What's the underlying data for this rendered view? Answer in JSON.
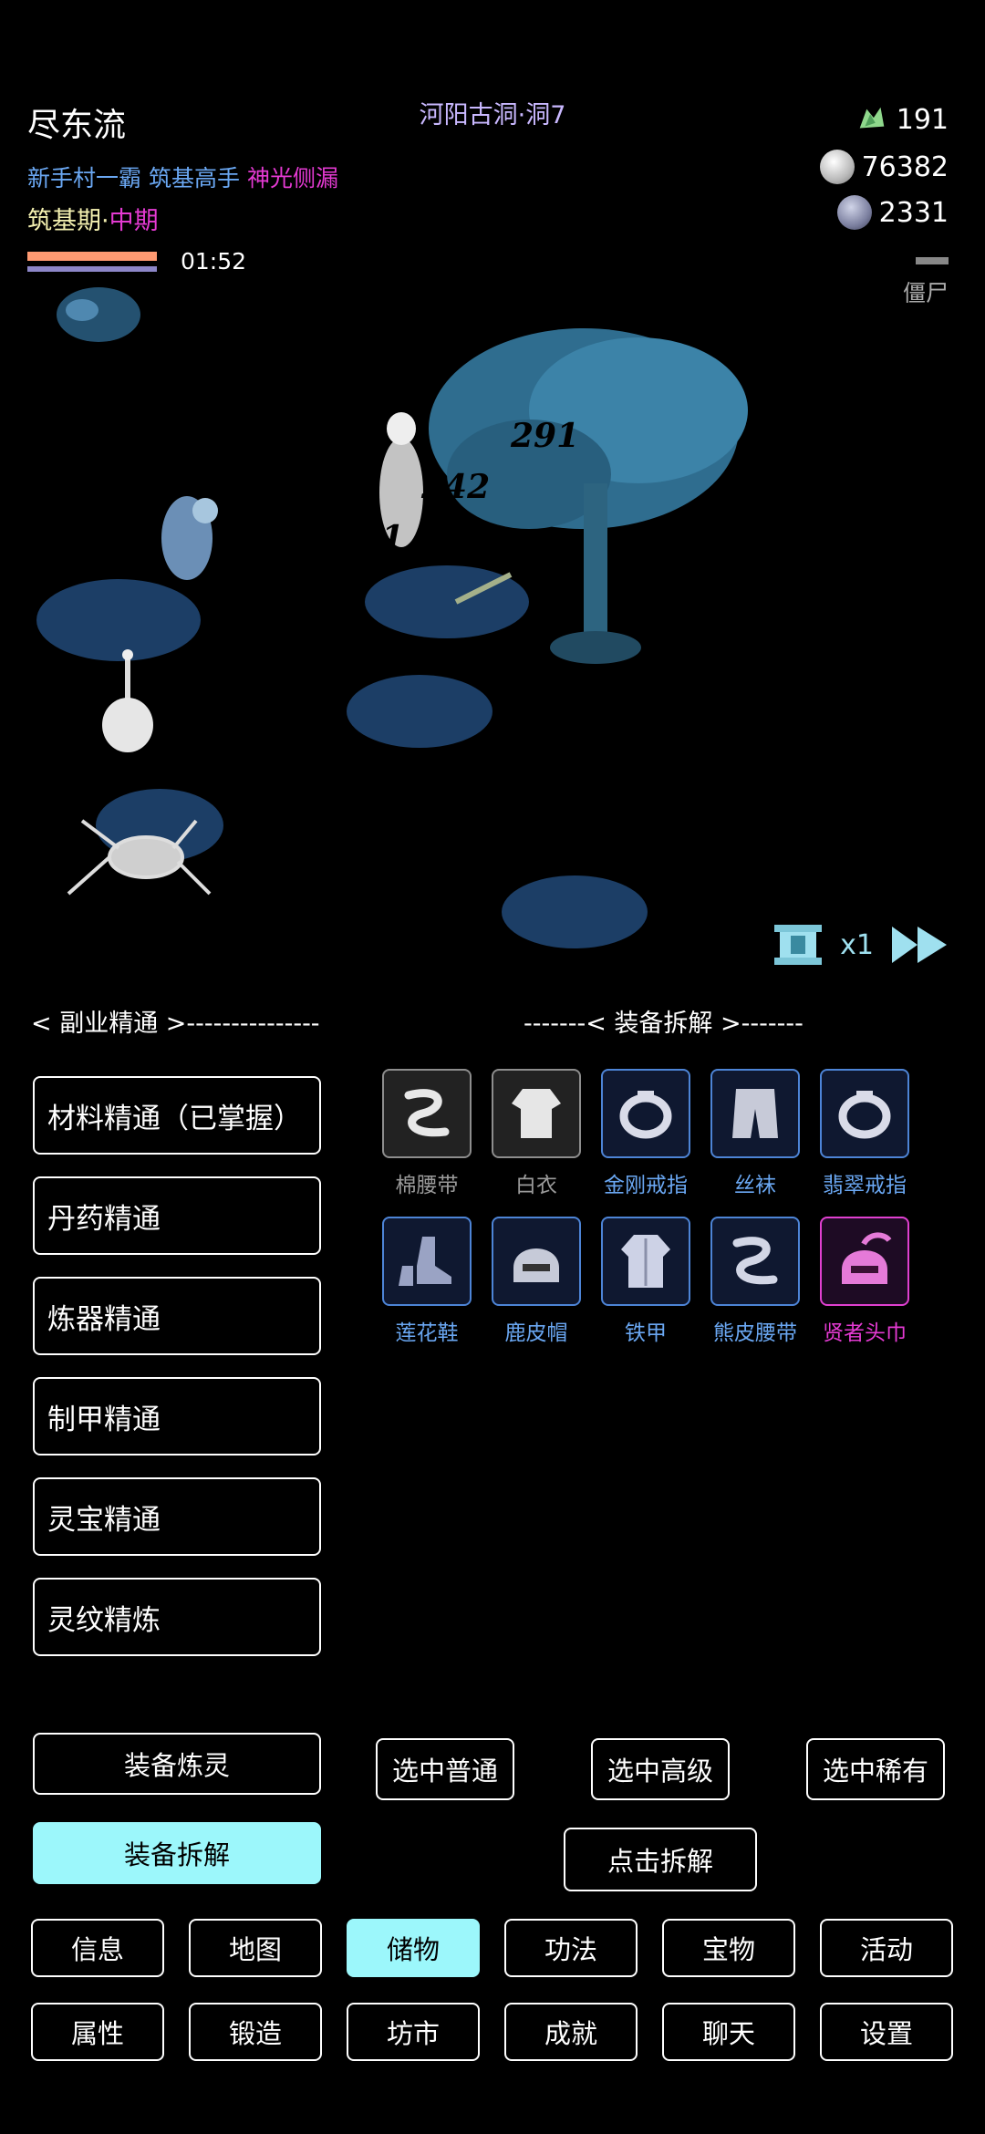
{
  "header": {
    "player_name": "尽东流",
    "location": "河阳古洞·洞7",
    "titles": [
      {
        "text": "新手村一霸",
        "color": "#6aa7f2"
      },
      {
        "text": "筑基高手",
        "color": "#6aa7f2"
      },
      {
        "text": "神光侧漏",
        "color": "#e43ad2"
      }
    ],
    "realm": "筑基期",
    "realm_sep": "·",
    "realm_stage": "中期",
    "timer": "01:52",
    "resources": {
      "jade": "191",
      "silver": "76382",
      "gray": "2331"
    },
    "enemy_name": "僵尸"
  },
  "battle": {
    "damage_numbers": [
      "291",
      "242",
      "411"
    ],
    "speed_label": "x1"
  },
  "sections": {
    "left_title": "< 副业精通 >---------------",
    "right_title": "-------< 装备拆解 >-------"
  },
  "mastery": [
    "材料精通（已掌握）",
    "丹药精通",
    "炼器精通",
    "制甲精通",
    "灵宝精通",
    "灵纹精炼"
  ],
  "items": [
    {
      "name": "棉腰带",
      "quality": "gray",
      "icon": "belt-icon"
    },
    {
      "name": "白衣",
      "quality": "gray",
      "icon": "robe-icon"
    },
    {
      "name": "金刚戒指",
      "quality": "blue",
      "icon": "ring-icon"
    },
    {
      "name": "丝袜",
      "quality": "blue",
      "icon": "leggings-icon"
    },
    {
      "name": "翡翠戒指",
      "quality": "blue",
      "icon": "ring-icon"
    },
    {
      "name": "莲花鞋",
      "quality": "blue",
      "icon": "boots-icon"
    },
    {
      "name": "鹿皮帽",
      "quality": "blue",
      "icon": "helmet-icon"
    },
    {
      "name": "铁甲",
      "quality": "blue",
      "icon": "armor-icon"
    },
    {
      "name": "熊皮腰带",
      "quality": "blue",
      "icon": "belt-icon"
    },
    {
      "name": "贤者头巾",
      "quality": "pink",
      "icon": "helmet-icon"
    }
  ],
  "actions": {
    "refine": "装备炼灵",
    "dismantle": "装备拆解",
    "select_normal": "选中普通",
    "select_advanced": "选中高级",
    "select_rare": "选中稀有",
    "click_dismantle": "点击拆解"
  },
  "nav": {
    "row1": [
      "信息",
      "地图",
      "储物",
      "功法",
      "宝物",
      "活动"
    ],
    "row2": [
      "属性",
      "锻造",
      "坊市",
      "成就",
      "聊天",
      "设置"
    ],
    "active": "储物"
  },
  "colors": {
    "accent": "#9cf7fb",
    "realm_stage": "#e43ad2",
    "damage": "#e0222a"
  }
}
